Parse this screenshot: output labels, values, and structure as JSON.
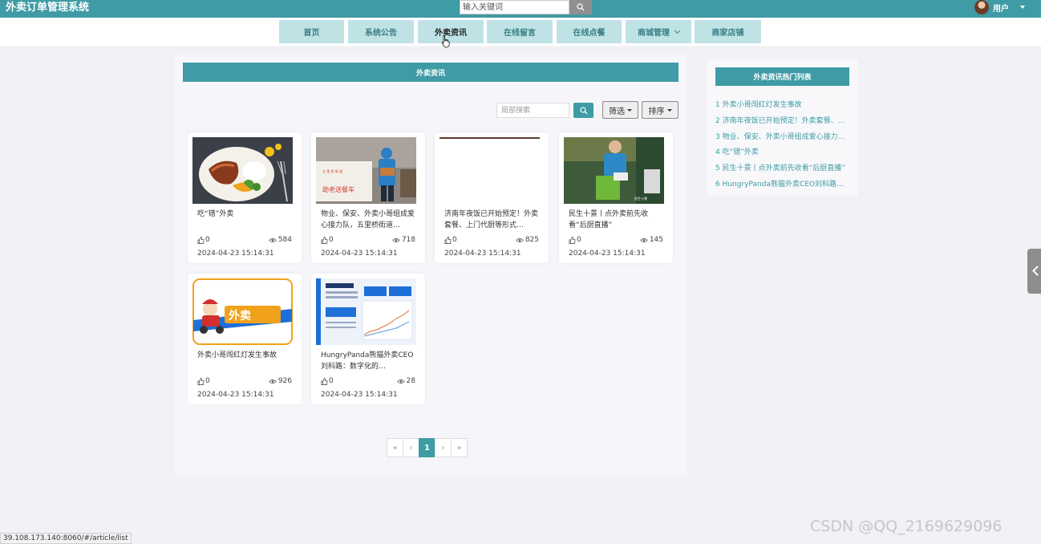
{
  "header": {
    "app_title": "外卖订单管理系统",
    "search_placeholder": "输入关键词",
    "user_label": "用户"
  },
  "nav": {
    "items": [
      {
        "label": "首页"
      },
      {
        "label": "系统公告"
      },
      {
        "label": "外卖资讯",
        "active": true
      },
      {
        "label": "在线留言"
      },
      {
        "label": "在线点餐"
      },
      {
        "label": "商城管理",
        "has_dropdown": true
      },
      {
        "label": "商家店铺"
      }
    ]
  },
  "main": {
    "panel_title": "外卖资讯",
    "local_search_placeholder": "局部搜索",
    "filter_label": "筛选",
    "sort_label": "排序",
    "articles": [
      {
        "title": "吃“错”外卖",
        "likes": "0",
        "views": "584",
        "date": "2024-04-23 15:14:31",
        "image": "grilled-chicken-rice"
      },
      {
        "title": "物业、保安、外卖小哥组成爱心接力队，五里桥街道…",
        "likes": "0",
        "views": "718",
        "date": "2024-04-23 15:14:31",
        "image": "courier-with-sign"
      },
      {
        "title": "济南年夜饭已开始预定！外卖套餐、上门代厨等形式…",
        "likes": "0",
        "views": "825",
        "date": "2024-04-23 15:14:31",
        "image": "blank"
      },
      {
        "title": "民生十景丨点外卖前先收看“后厨直播”",
        "likes": "0",
        "views": "145",
        "date": "2024-04-23 15:14:31",
        "image": "courier-in-market"
      },
      {
        "title": "外卖小哥闯红灯发生事故",
        "likes": "0",
        "views": "926",
        "date": "2024-04-23 15:14:31",
        "image": "delivery-logo"
      },
      {
        "title": "HungryPanda熊猫外卖CEO刘科路：数字化的…",
        "likes": "0",
        "views": "28",
        "date": "2024-04-23 15:14:31",
        "image": "data-slide"
      }
    ],
    "pagination": [
      "«",
      "‹",
      "1",
      "›",
      "»"
    ],
    "current_page": "1"
  },
  "sidebar": {
    "title": "外卖资讯热门列表",
    "items": [
      "1  外卖小哥闯红灯发生事故",
      "2  济南年夜饭已开始预定！外卖套餐、上门代厨等形式…",
      "3  物业、保安、外卖小哥组成爱心接力队，五里桥街道…",
      "4  吃“错”外卖",
      "5  民生十景丨点外卖前先收看“后厨直播”",
      "6  HungryPanda熊猫外卖CEO刘科路：数字化的…"
    ]
  },
  "status_bar": {
    "url": "39.108.173.140:8060/#/article/list"
  },
  "watermark": "CSDN @QQ_2169629096",
  "colors": {
    "accent": "#3f9ba5",
    "nav_bg": "#bfe3e5",
    "page_bg": "#f1f1f6"
  }
}
